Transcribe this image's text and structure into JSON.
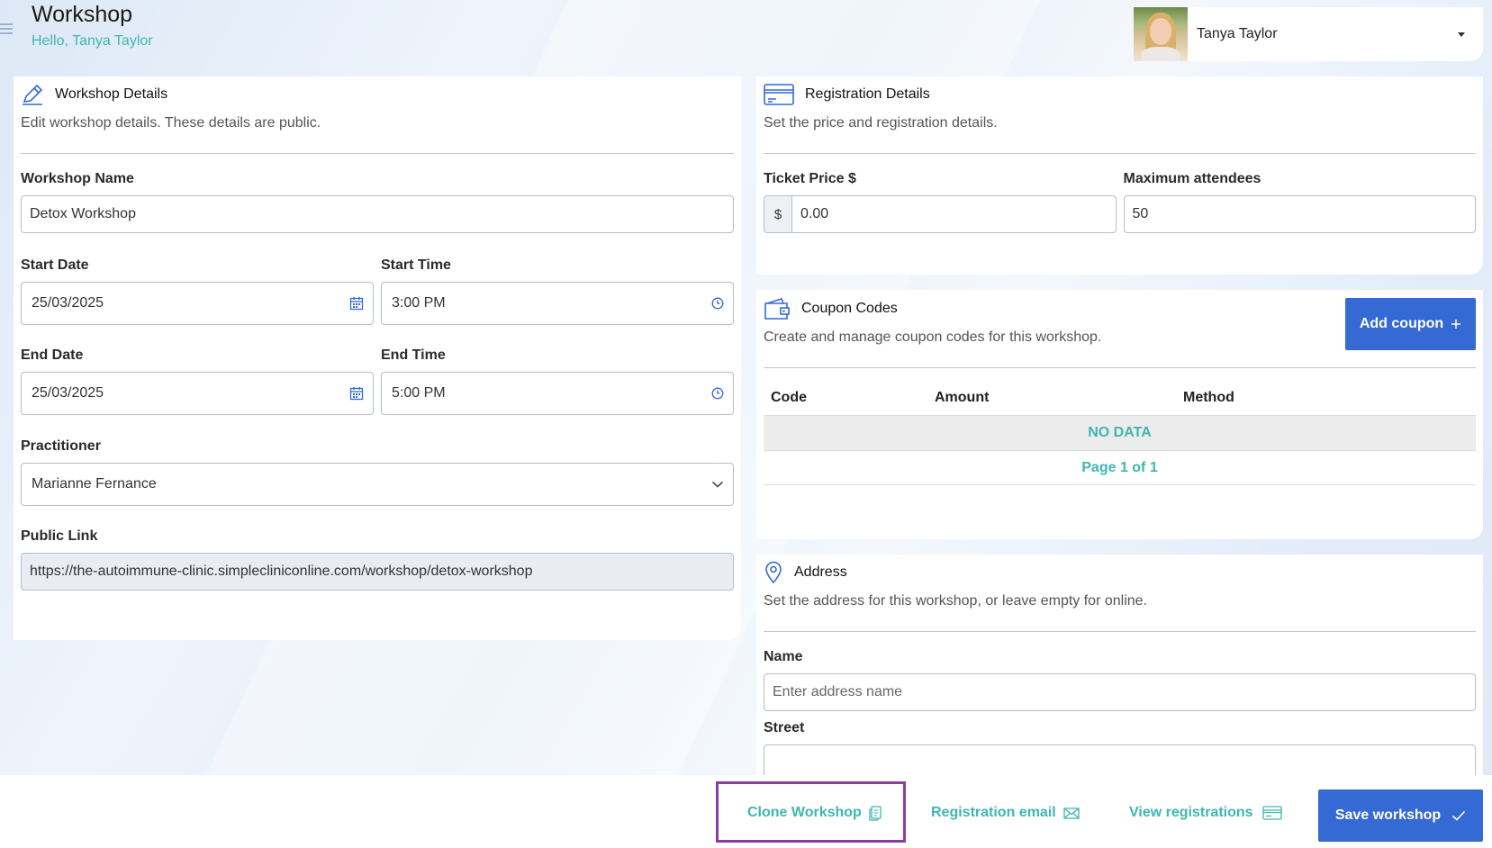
{
  "header": {
    "title": "Workshop",
    "greeting": "Hello, Tanya Taylor",
    "user_name": "Tanya Taylor"
  },
  "workshop_details": {
    "title": "Workshop Details",
    "subtitle": "Edit workshop details. These details are public.",
    "name_label": "Workshop Name",
    "name_value": "Detox Workshop",
    "start_date_label": "Start Date",
    "start_date_value": "25/03/2025",
    "start_time_label": "Start Time",
    "start_time_value": "3:00 PM",
    "end_date_label": "End Date",
    "end_date_value": "25/03/2025",
    "end_time_label": "End Time",
    "end_time_value": "5:00 PM",
    "practitioner_label": "Practitioner",
    "practitioner_value": "Marianne Fernance",
    "public_link_label": "Public Link",
    "public_link_value": "https://the-autoimmune-clinic.simplecliniconline.com/workshop/detox-workshop"
  },
  "registration_details": {
    "title": "Registration Details",
    "subtitle": "Set the price and registration details.",
    "ticket_price_label": "Ticket Price $",
    "currency_prefix": "$",
    "ticket_price_value": "0.00",
    "max_attendees_label": "Maximum attendees",
    "max_attendees_value": "50"
  },
  "coupon_codes": {
    "title": "Coupon Codes",
    "subtitle": "Create and manage coupon codes for this workshop.",
    "add_button": "Add coupon",
    "columns": [
      "Code",
      "Amount",
      "Method"
    ],
    "empty_text": "NO DATA",
    "pager_text": "Page 1 of 1"
  },
  "address": {
    "title": "Address",
    "subtitle": "Set the address for this workshop, or leave empty for online.",
    "name_label": "Name",
    "name_placeholder": "Enter address name",
    "street_label": "Street"
  },
  "footer": {
    "clone": "Clone Workshop",
    "registration_email": "Registration email",
    "view_registrations": "View registrations",
    "save": "Save workshop"
  },
  "colors": {
    "accent_teal": "#3fb6b0",
    "primary_blue": "#3569d4",
    "highlight_purple": "#8b3ca0"
  }
}
